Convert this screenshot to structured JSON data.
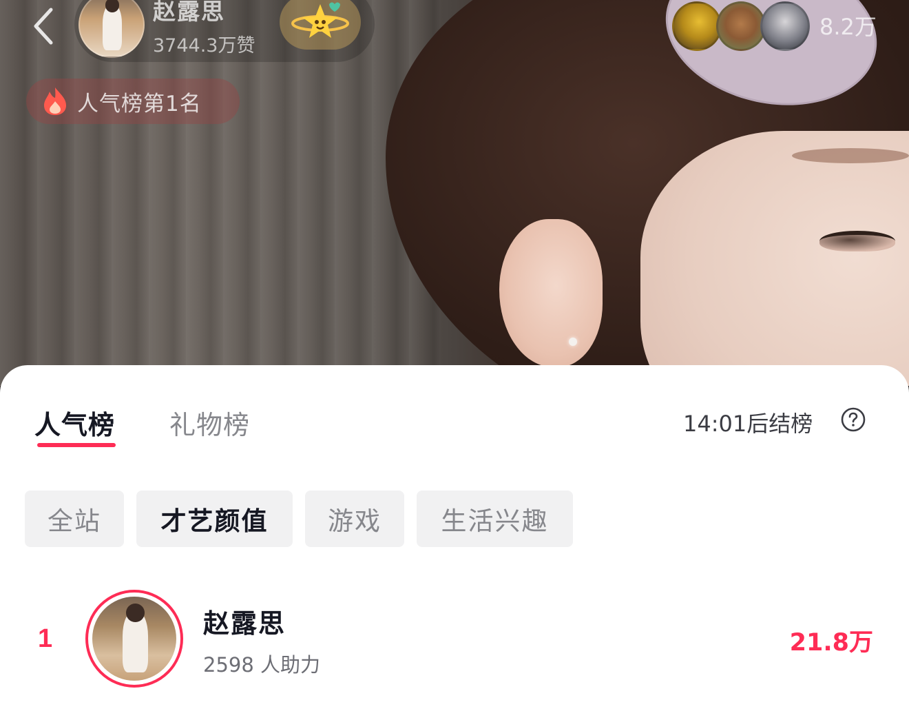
{
  "header": {
    "host_name": "赵露思",
    "host_likes": "3744.3万赞",
    "viewer_count": "8.2万",
    "rank_badge": "人气榜第1名"
  },
  "sheet": {
    "tabs": [
      {
        "label": "人气榜",
        "active": true
      },
      {
        "label": "礼物榜",
        "active": false
      }
    ],
    "countdown": "14:01后结榜",
    "categories": [
      {
        "label": "全站",
        "active": false
      },
      {
        "label": "才艺颜值",
        "active": true
      },
      {
        "label": "游戏",
        "active": false
      },
      {
        "label": "生活兴趣",
        "active": false
      }
    ],
    "ranking": [
      {
        "rank": "1",
        "name": "赵露思",
        "assist": "2598 人助力",
        "score": "21.8万"
      }
    ]
  },
  "colors": {
    "accent": "#fe2c55",
    "text_primary": "#161823",
    "text_secondary": "#86878c",
    "chip_bg": "#f1f1f2"
  },
  "icons": [
    "back-arrow-icon",
    "star-planet-icon",
    "fire-icon",
    "question-circle-icon"
  ]
}
